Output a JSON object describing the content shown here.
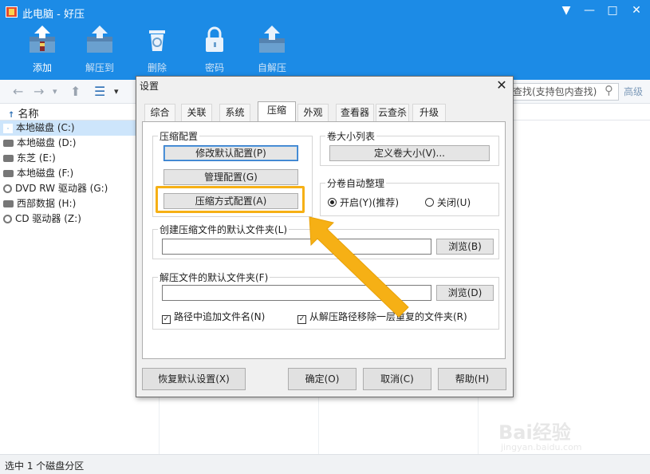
{
  "window": {
    "title": "此电脑 - 好压",
    "controls": [
      "▼",
      "—",
      "□",
      "✕"
    ]
  },
  "toolbar": [
    {
      "label": "添加",
      "icon": "add-archive-icon",
      "active": true
    },
    {
      "label": "解压到",
      "icon": "extract-icon",
      "active": false
    },
    {
      "label": "删除",
      "icon": "trash-icon",
      "active": false
    },
    {
      "label": "密码",
      "icon": "lock-icon",
      "active": false
    },
    {
      "label": "自解压",
      "icon": "self-extract-icon",
      "active": false
    }
  ],
  "nav": {
    "search_placeholder": "查找(支持包内查找)",
    "advanced": "高级"
  },
  "columns": {
    "name": "名称"
  },
  "drives": [
    {
      "label": "本地磁盘 (C:)",
      "selected": true,
      "kind": "system"
    },
    {
      "label": "本地磁盘 (D:)",
      "selected": false,
      "kind": "disk"
    },
    {
      "label": "东芝 (E:)",
      "selected": false,
      "kind": "disk"
    },
    {
      "label": "本地磁盘 (F:)",
      "selected": false,
      "kind": "disk"
    },
    {
      "label": "DVD RW 驱动器 (G:)",
      "selected": false,
      "kind": "cd"
    },
    {
      "label": "西部数据 (H:)",
      "selected": false,
      "kind": "disk"
    },
    {
      "label": "CD 驱动器 (Z:)",
      "selected": false,
      "kind": "cd"
    }
  ],
  "status": "选中 1 个磁盘分区",
  "watermark": {
    "brand": "Bai经验",
    "url": "jingyan.baidu.com"
  },
  "dialog": {
    "title": "设置",
    "tabs": [
      "综合",
      "关联",
      "系统",
      "压缩",
      "外观",
      "查看器",
      "云查杀",
      "升级"
    ],
    "active_tab": "压缩",
    "compress_config": {
      "label": "压缩配置",
      "buttons": [
        "修改默认配置(P)",
        "管理配置(G)",
        "压缩方式配置(A)"
      ]
    },
    "volume_list": {
      "label": "卷大小列表",
      "button": "定义卷大小(V)..."
    },
    "auto_volume": {
      "label": "分卷自动整理",
      "on": "开启(Y)(推荐)",
      "off": "关闭(U)",
      "selected": "on"
    },
    "compress_folder": {
      "label": "创建压缩文件的默认文件夹(L)",
      "value": "",
      "browse": "浏览(B)"
    },
    "extract_folder": {
      "label": "解压文件的默认文件夹(F)",
      "value": "",
      "browse": "浏览(D)"
    },
    "checkboxes": [
      {
        "label": "路径中追加文件名(N)",
        "checked": true
      },
      {
        "label": "从解压路径移除一层重复的文件夹(R)",
        "checked": true
      }
    ],
    "footer": {
      "restore": "恢复默认设置(X)",
      "ok": "确定(O)",
      "cancel": "取消(C)",
      "help": "帮助(H)"
    }
  },
  "colors": {
    "titlebar": "#1c8be6",
    "highlight": "#f6b015",
    "selected_row": "#cde5fb"
  }
}
